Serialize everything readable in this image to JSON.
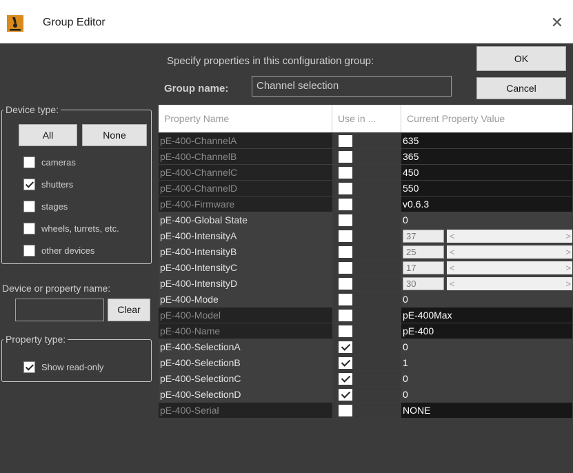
{
  "window": {
    "title": "Group Editor",
    "app_icon": "microscope-icon",
    "close_icon": "close-icon",
    "close_glyph": "✕"
  },
  "header": {
    "instruction": "Specify properties in this configuration group:",
    "group_name_label": "Group name:",
    "group_name_value": "Channel selection"
  },
  "buttons": {
    "ok": "OK",
    "cancel": "Cancel",
    "all": "All",
    "none": "None",
    "clear": "Clear"
  },
  "device_type": {
    "title": "Device type:",
    "options": [
      {
        "label": "cameras",
        "checked": false
      },
      {
        "label": "shutters",
        "checked": true
      },
      {
        "label": "stages",
        "checked": false
      },
      {
        "label": "wheels, turrets, etc.",
        "checked": false
      },
      {
        "label": "other devices",
        "checked": false
      }
    ]
  },
  "search": {
    "label": "Device or property name:",
    "value": ""
  },
  "property_type": {
    "title": "Property type:",
    "options": [
      {
        "label": "Show read-only",
        "checked": true
      }
    ]
  },
  "table": {
    "columns": [
      "Property Name",
      "Use in ...",
      "Current Property Value"
    ],
    "rows": [
      {
        "name": "pE-400-ChannelA",
        "use": false,
        "value": "635",
        "read_only": true
      },
      {
        "name": "pE-400-ChannelB",
        "use": false,
        "value": "365",
        "read_only": true
      },
      {
        "name": "pE-400-ChannelC",
        "use": false,
        "value": "450",
        "read_only": true
      },
      {
        "name": "pE-400-ChannelD",
        "use": false,
        "value": "550",
        "read_only": true
      },
      {
        "name": "pE-400-Firmware",
        "use": false,
        "value": "v0.6.3",
        "read_only": true
      },
      {
        "name": "pE-400-Global State",
        "use": false,
        "value": "0",
        "read_only": false
      },
      {
        "name": "pE-400-IntensityA",
        "use": false,
        "value": "37",
        "read_only": false,
        "slider": true,
        "arrow_left": "<",
        "arrow_right": ">"
      },
      {
        "name": "pE-400-IntensityB",
        "use": false,
        "value": "25",
        "read_only": false,
        "slider": true,
        "arrow_left": "<",
        "arrow_right": ">"
      },
      {
        "name": "pE-400-IntensityC",
        "use": false,
        "value": "17",
        "read_only": false,
        "slider": true,
        "arrow_left": "<",
        "arrow_right": ">"
      },
      {
        "name": "pE-400-IntensityD",
        "use": false,
        "value": "30",
        "read_only": false,
        "slider": true,
        "arrow_left": "<",
        "arrow_right": ">"
      },
      {
        "name": "pE-400-Mode",
        "use": false,
        "value": "0",
        "read_only": false
      },
      {
        "name": "pE-400-Model",
        "use": false,
        "value": "pE-400Max",
        "read_only": true
      },
      {
        "name": "pE-400-Name",
        "use": false,
        "value": "pE-400",
        "read_only": true
      },
      {
        "name": "pE-400-SelectionA",
        "use": true,
        "value": "0",
        "read_only": false
      },
      {
        "name": "pE-400-SelectionB",
        "use": true,
        "value": "1",
        "read_only": false
      },
      {
        "name": "pE-400-SelectionC",
        "use": true,
        "value": "0",
        "read_only": false
      },
      {
        "name": "pE-400-SelectionD",
        "use": true,
        "value": "0",
        "read_only": false
      },
      {
        "name": "pE-400-Serial",
        "use": false,
        "value": "NONE",
        "read_only": true
      }
    ]
  },
  "colors": {
    "panel_bg": "#3b3b3b",
    "readonly_name_bg": "#232323",
    "readonly_value_bg": "#171717",
    "editable_bg": "#3f3f3f"
  }
}
